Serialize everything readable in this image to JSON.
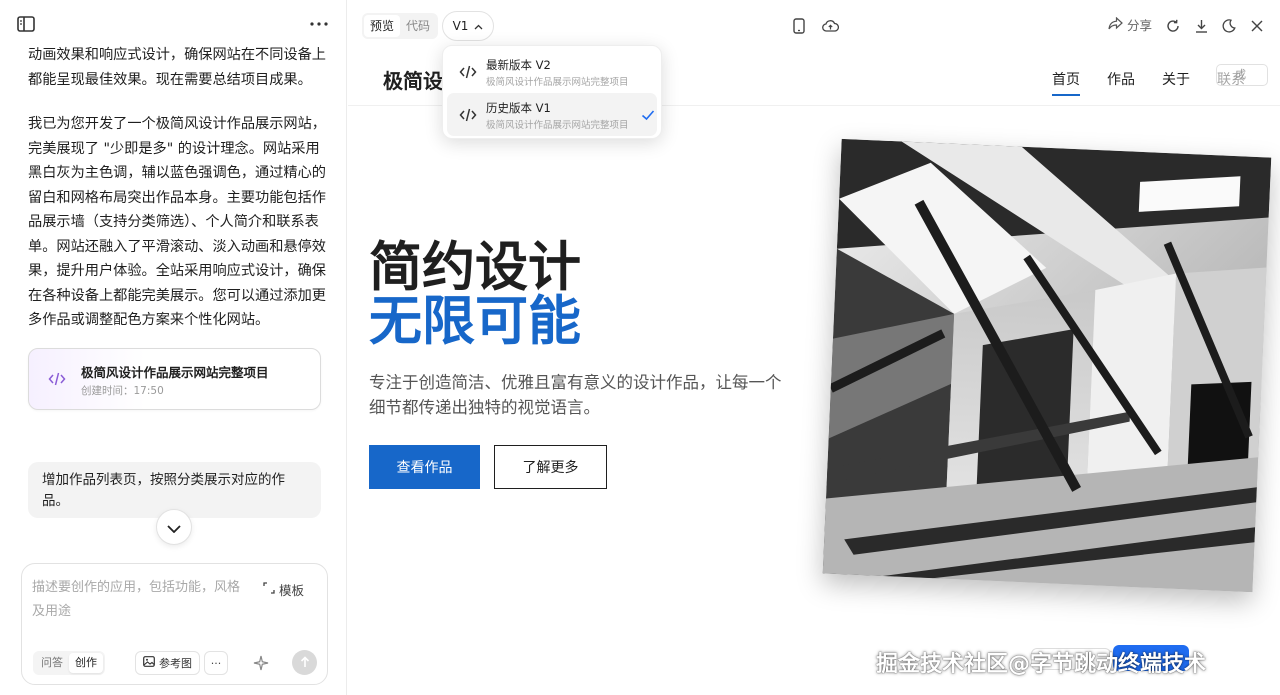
{
  "left_panel": {
    "message_1": "动画效果和响应式设计，确保网站在不同设备上都能呈现最佳效果。现在需要总结项目成果。",
    "message_2": "我已为您开发了一个极简风设计作品展示网站，完美展现了 \"少即是多\" 的设计理念。网站采用黑白灰为主色调，辅以蓝色强调色，通过精心的留白和网格布局突出作品本身。主要功能包括作品展示墙（支持分类筛选）、个人简介和联系表单。网站还融入了平滑滚动、淡入动画和悬停效果，提升用户体验。全站采用响应式设计，确保在各种设备上都能完美展示。您可以通过添加更多作品或调整配色方案来个性化网站。",
    "project_card": {
      "title": "极简风设计作品展示网站完整项目",
      "time": "创建时间：17:50",
      "icon": "code-icon"
    },
    "user_message": "增加作品列表页，按照分类展示对应的作品。",
    "composer": {
      "placeholder": "描述要创作的应用，包括功能，风格及用途",
      "template_label": "模板",
      "mode_options": [
        "问答",
        "创作"
      ],
      "mode_selected": "创作",
      "reference_label": "参考图",
      "more_label": "···"
    }
  },
  "toolbar": {
    "view_tabs": [
      "预览",
      "代码"
    ],
    "view_selected": "预览",
    "version_label": "V1",
    "share_label": "分享",
    "icons": [
      "mobile-icon",
      "cloud-icon",
      "share-icon",
      "refresh-icon",
      "download-icon",
      "dark-mode-icon",
      "close-icon"
    ]
  },
  "version_dropdown": {
    "items": [
      {
        "title": "最新版本 V2",
        "desc": "极简风设计作品展示网站完整项目",
        "selected": false
      },
      {
        "title": "历史版本 V1",
        "desc": "极简风设计作品展示网站完整项目",
        "selected": true
      }
    ]
  },
  "site": {
    "logo": "极简设",
    "nav": [
      "首页",
      "作品",
      "关于",
      "联系"
    ],
    "nav_active": "首页",
    "badge": "成",
    "hero_title_1": "简约设计",
    "hero_title_2": "无限可能",
    "hero_subtitle": "专注于创造简洁、优雅且富有意义的设计作品，让每一个细节都传递出独特的视觉语言。",
    "primary_button": "查看作品",
    "secondary_button": "了解更多",
    "accent_color": "#1767c9"
  },
  "watermark": "掘金技术社区@字节跳动终端技术"
}
